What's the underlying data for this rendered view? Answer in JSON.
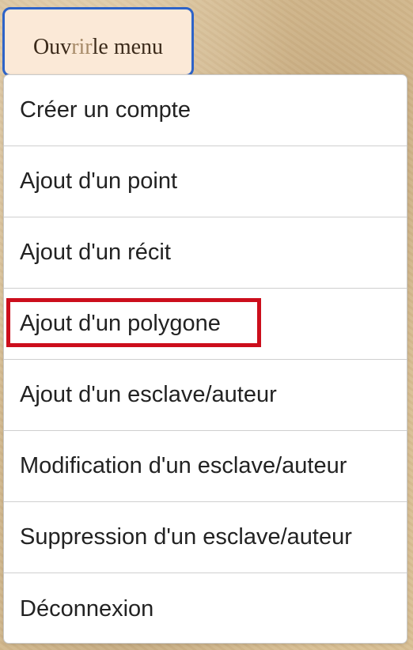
{
  "menu_button": {
    "label_part1": "Ouv",
    "label_muted": "rir",
    "label_part2": " le menu"
  },
  "dropdown": {
    "items": [
      {
        "label": "Créer un compte"
      },
      {
        "label": "Ajout d'un point"
      },
      {
        "label": "Ajout d'un récit"
      },
      {
        "label": "Ajout d'un polygone",
        "highlighted": true
      },
      {
        "label": "Ajout d'un esclave/auteur"
      },
      {
        "label": "Modification d'un esclave/auteur"
      },
      {
        "label": "Suppression d'un esclave/auteur"
      },
      {
        "label": "Déconnexion"
      }
    ]
  },
  "colors": {
    "focus_border": "#2d63c8",
    "highlight_border": "#cc0e1c",
    "button_background": "#fbe9d7",
    "page_background": "#d8bf94"
  }
}
